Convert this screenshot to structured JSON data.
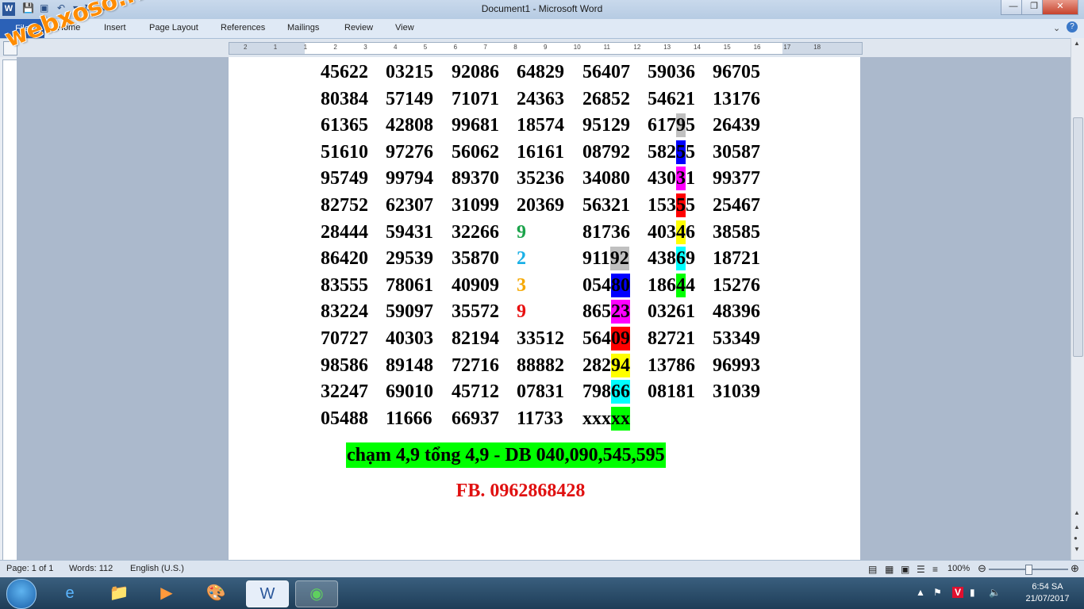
{
  "window": {
    "title": "Document1  -  Microsoft Word"
  },
  "ribbon": {
    "file_tab": "File",
    "tabs": [
      "Home",
      "Insert",
      "Page Layout",
      "References",
      "Mailings",
      "Review",
      "View"
    ]
  },
  "ruler": {
    "labels": [
      "2",
      "1",
      "1",
      "2",
      "3",
      "4",
      "5",
      "6",
      "7",
      "8",
      "9",
      "10",
      "11",
      "12",
      "13",
      "14",
      "15",
      "16",
      "17",
      "18"
    ]
  },
  "document": {
    "rows": [
      [
        "45622",
        "03215",
        "92086",
        "64829",
        "56407",
        "59036",
        "96705"
      ],
      [
        "80384",
        "57149",
        "71071",
        "24363",
        "26852",
        "54621",
        "13176"
      ],
      [
        "61365",
        "42808",
        "99681",
        "18574",
        "95129",
        "61795",
        "26439"
      ],
      [
        "51610",
        "97276",
        "56062",
        "16161",
        "08792",
        "58255",
        "30587"
      ],
      [
        "95749",
        "99794",
        "89370",
        "35236",
        "34080",
        "43031",
        "99377"
      ],
      [
        "82752",
        "62307",
        "31099",
        "20369",
        "56321",
        "15355",
        "25467"
      ],
      [
        "28444",
        "59431",
        "32266",
        "9",
        "81736",
        "40346",
        "38585"
      ],
      [
        "86420",
        "29539",
        "35870",
        "2",
        "91192",
        "43869",
        "18721"
      ],
      [
        "83555",
        "78061",
        "40909",
        "3",
        "05480",
        "18644",
        "15276"
      ],
      [
        "83224",
        "59097",
        "35572",
        "9",
        "86523",
        "03261",
        "48396"
      ],
      [
        "70727",
        "40303",
        "82194",
        "33512",
        "56409",
        "82721",
        "53349"
      ],
      [
        "98586",
        "89148",
        "72716",
        "88882",
        "28294",
        "13786",
        "96993"
      ],
      [
        "32247",
        "69010",
        "45712",
        "07831",
        "79866",
        "08181",
        "31039"
      ],
      [
        "05488",
        "11666",
        "66937",
        "11733",
        "xxxxx",
        "",
        ""
      ]
    ],
    "single_digit_colors": {
      "6": "#1aa34a",
      "7": "#1ab0e6",
      "8": "#f5a800",
      "9": "#e81010"
    },
    "highlights": {
      "col4": {
        "7": "#c0c0c0",
        "8": "#0000ff",
        "9": "#ff00ff",
        "10": "#ff0000",
        "11": "#ffff00",
        "12": "#00ffff",
        "13": "#00ff00"
      },
      "col5": {
        "2": "#c0c0c0",
        "3": "#0000ff",
        "4": "#ff00ff",
        "5": "#ff0000",
        "6": "#ffff00",
        "7": "#00ffff",
        "8": "#00ff00"
      }
    },
    "note": "chạm 4,9 tổng 4,9 - DB 040,090,545,595",
    "contact": "FB. 0962868428"
  },
  "status_bar": {
    "page": "Page: 1 of 1",
    "words": "Words: 112",
    "language": "English (U.S.)",
    "zoom": "100%",
    "zoom_level": 100
  },
  "taskbar": {
    "time": "6:54 SA",
    "date": "21/07/2017"
  },
  "watermark": "webxoso.net"
}
